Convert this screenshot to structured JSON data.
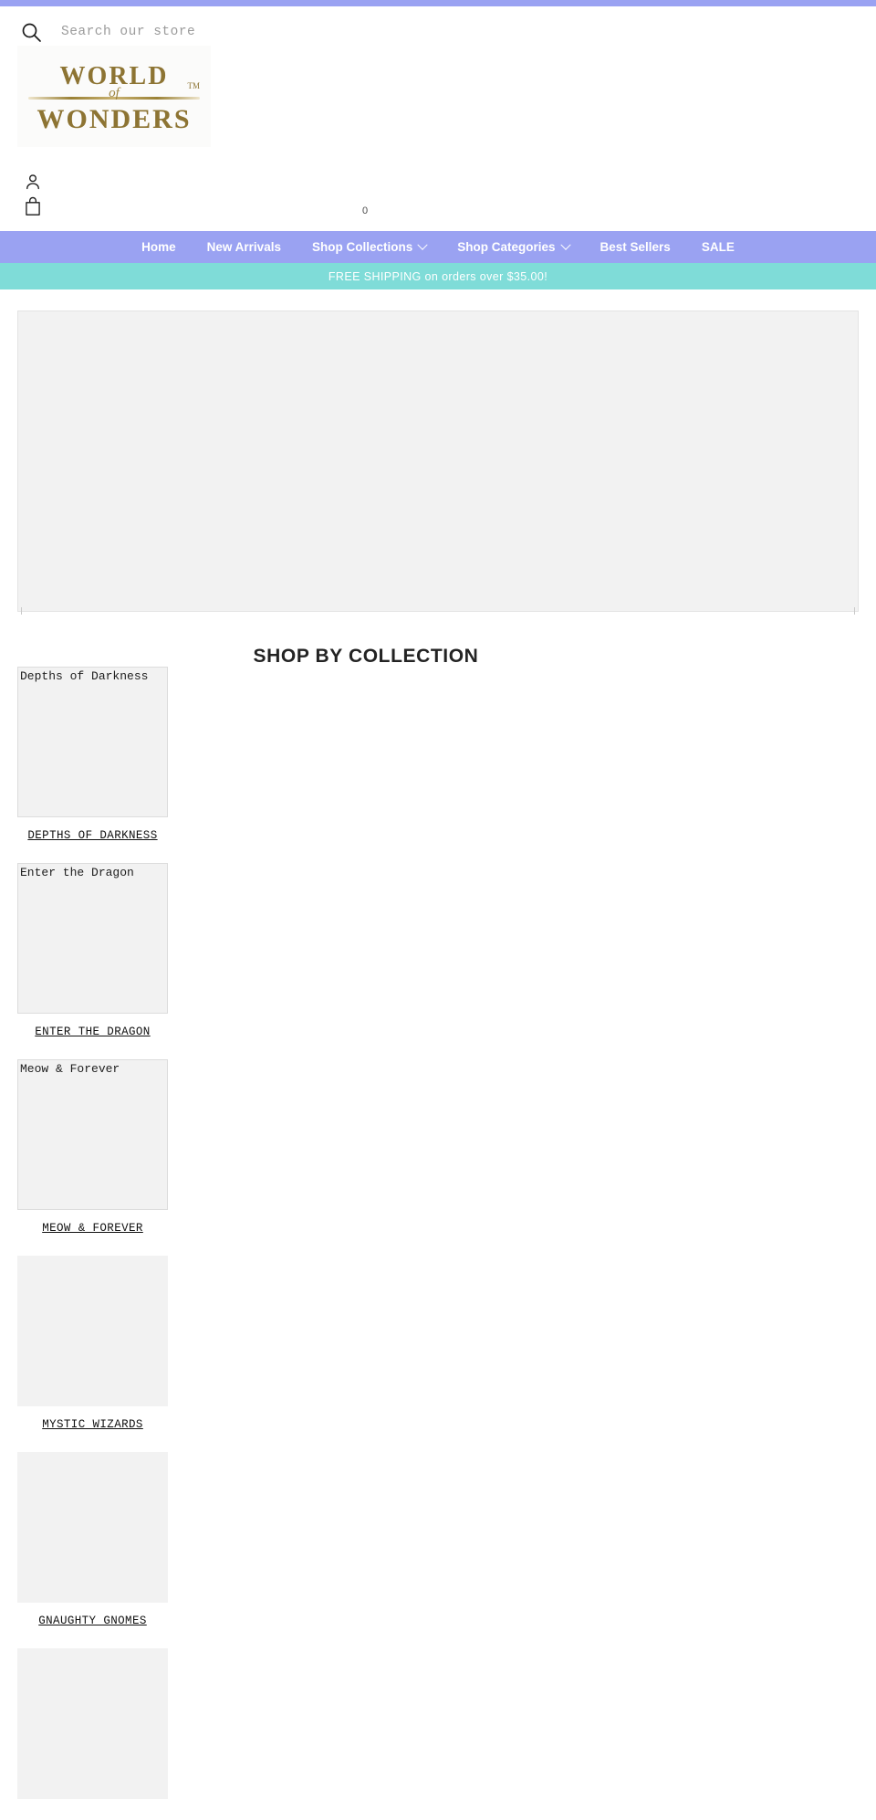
{
  "brand": {
    "logo_line1": "WORLD",
    "logo_of": "of",
    "logo_line2": "WONDERS",
    "logo_tm": "TM",
    "gold": "#8d7433"
  },
  "colors": {
    "accent_purple": "#9aa2f2",
    "banner_teal": "#7fdcd8",
    "placeholder_gray": "#f2f2f2"
  },
  "search": {
    "placeholder": "Search our store",
    "value": "",
    "icon": "search-icon"
  },
  "header": {
    "account_icon": "user-icon",
    "cart_icon": "shopping-bag-icon",
    "cart_count": "0"
  },
  "nav": {
    "items": [
      {
        "label": "Home",
        "has_dropdown": false
      },
      {
        "label": "New Arrivals",
        "has_dropdown": false
      },
      {
        "label": "Shop Collections",
        "has_dropdown": true
      },
      {
        "label": "Shop Categories",
        "has_dropdown": true
      },
      {
        "label": "Best Sellers",
        "has_dropdown": false
      },
      {
        "label": "SALE",
        "has_dropdown": false
      }
    ]
  },
  "announcement": {
    "text": "FREE SHIPPING on orders over $35.00!"
  },
  "main": {
    "section_title": "SHOP BY COLLECTION",
    "collections": [
      {
        "alt": "Depths of Darkness",
        "label": "DEPTHS OF DARKNESS",
        "has_alt": true
      },
      {
        "alt": "Enter the Dragon",
        "label": "ENTER THE DRAGON",
        "has_alt": true
      },
      {
        "alt": "Meow & Forever",
        "label": "MEOW & FOREVER",
        "has_alt": true
      },
      {
        "alt": "",
        "label": "MYSTIC WIZARDS",
        "has_alt": false
      },
      {
        "alt": "",
        "label": "GNAUGHTY GNOMES",
        "has_alt": false
      },
      {
        "alt": "",
        "label": "",
        "has_alt": false
      }
    ]
  }
}
